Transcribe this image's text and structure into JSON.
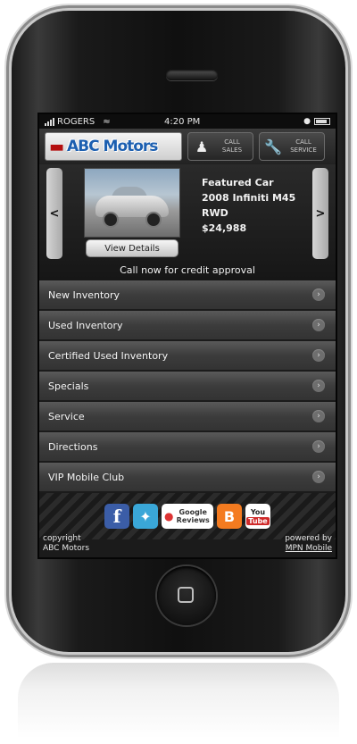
{
  "status": {
    "carrier": "ROGERS",
    "time": "4:20 PM"
  },
  "header": {
    "logo_text": "ABC Motors",
    "call_sales": "CALL SALES",
    "call_service": "CALL SERVICE"
  },
  "featured": {
    "prev": "<",
    "next": ">",
    "view_details": "View Details",
    "heading": "Featured Car",
    "model": "2008 Infiniti M45",
    "drive": "RWD",
    "price": "$24,988",
    "credit_note": "Call now for credit approval"
  },
  "menu": [
    {
      "label": "New Inventory"
    },
    {
      "label": "Used Inventory"
    },
    {
      "label": "Certified Used Inventory"
    },
    {
      "label": "Specials"
    },
    {
      "label": "Service"
    },
    {
      "label": "Directions"
    },
    {
      "label": "VIP Mobile Club"
    }
  ],
  "social": {
    "facebook": "f",
    "google_reviews": "Google Reviews",
    "youtube_you": "You",
    "youtube_tube": "Tube"
  },
  "footer": {
    "copyright_line1": "copyright",
    "copyright_line2": "ABC Motors",
    "powered_by": "powered by",
    "powered_link": "MPN Mobile"
  },
  "colors": {
    "menu_item": "#3c3c3c",
    "facebook": "#3b5da7",
    "twitter": "#3aa7d8",
    "blogger": "#f47b20",
    "youtube": "#cf2a2a"
  }
}
